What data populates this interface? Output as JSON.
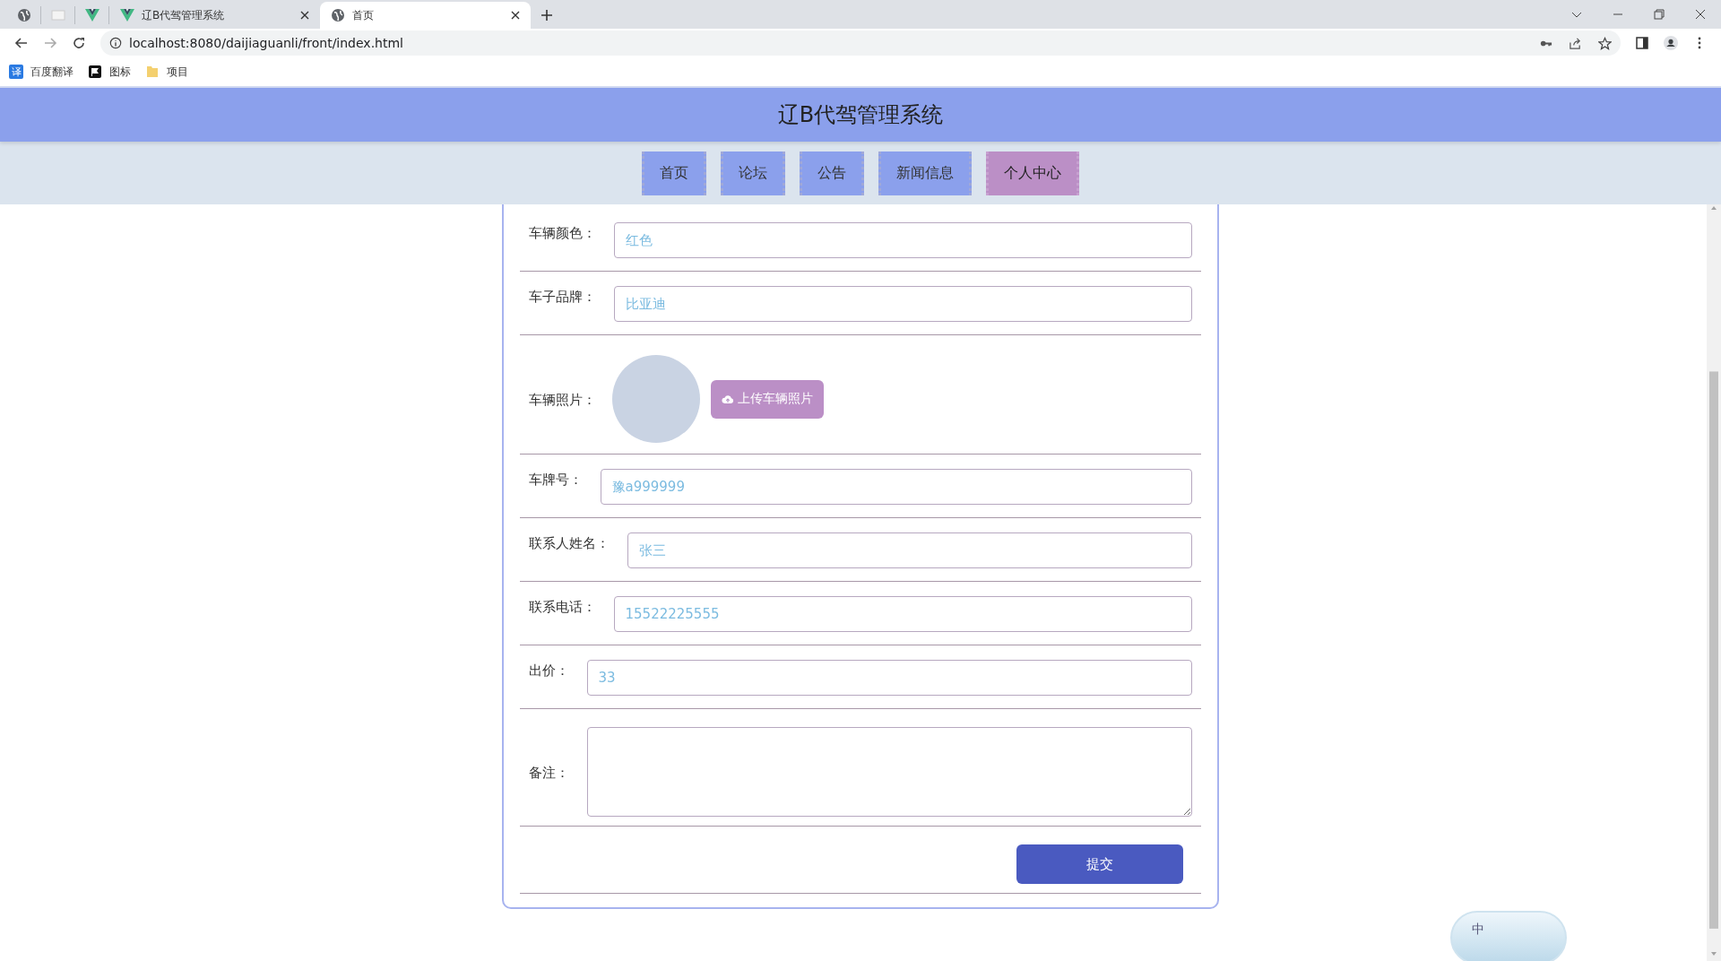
{
  "browser": {
    "tabs": [
      {
        "kind": "globe",
        "selected": false
      },
      {
        "kind": "page",
        "selected": false
      },
      {
        "kind": "vue",
        "selected": false
      },
      {
        "kind": "vue",
        "title": "辽B代驾管理系统",
        "selected": false
      },
      {
        "kind": "globe",
        "title": "首页",
        "selected": true
      }
    ],
    "url": "localhost:8080/daijiaguanli/front/index.html",
    "bookmarks": [
      {
        "kind": "translate",
        "badge": "译",
        "label": "百度翻译"
      },
      {
        "kind": "flag",
        "label": "图标"
      },
      {
        "kind": "folder",
        "label": "项目"
      }
    ]
  },
  "header": {
    "title": "辽B代驾管理系统"
  },
  "nav": [
    {
      "label": "首页",
      "selected": false
    },
    {
      "label": "论坛",
      "selected": false
    },
    {
      "label": "公告",
      "selected": false
    },
    {
      "label": "新闻信息",
      "selected": false
    },
    {
      "label": "个人中心",
      "selected": true
    }
  ],
  "form": {
    "rows": [
      {
        "kind": "input",
        "label": "车辆颜色：",
        "value": "红色"
      },
      {
        "kind": "input",
        "label": "车子品牌：",
        "value": "比亚迪"
      },
      {
        "kind": "image",
        "label": "车辆照片：",
        "button": "上传车辆照片"
      },
      {
        "kind": "input",
        "label": "车牌号：",
        "value": "豫a999999"
      },
      {
        "kind": "input",
        "label": "联系人姓名：",
        "value": "张三"
      },
      {
        "kind": "input",
        "label": "联系电话：",
        "value": "15522225555"
      },
      {
        "kind": "input",
        "label": "出价：",
        "value": "33"
      },
      {
        "kind": "textarea",
        "label": "备注：",
        "value": ""
      }
    ],
    "submit": "提交"
  },
  "ime": {
    "label": "中"
  }
}
